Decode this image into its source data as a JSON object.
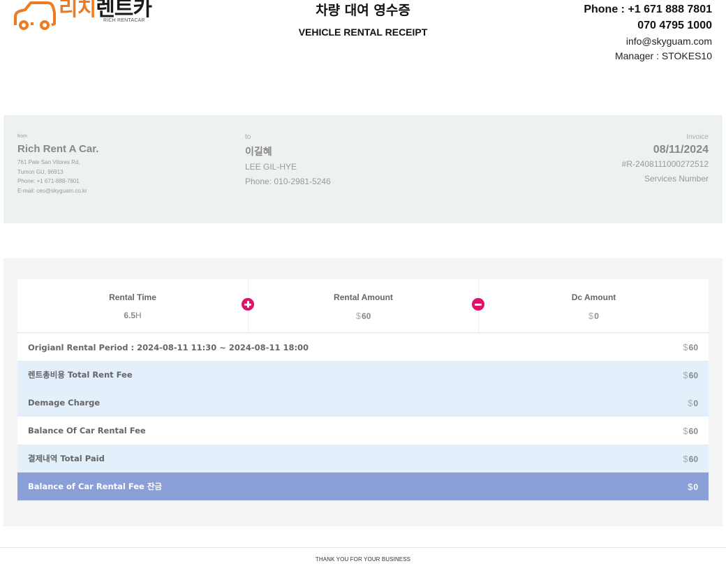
{
  "brand": {
    "name_ko_orange": "리치",
    "name_ko_dark": "렌트카",
    "name_en": "RICH RENTACAR",
    "accent_color": "#f07a1f",
    "icon": "car-logo-icon"
  },
  "title": {
    "ko": "차량 대여 영수증",
    "en": "VEHICLE RENTAL RECEIPT"
  },
  "contact": {
    "phone": "Phone : +1 671 888 7801",
    "phone2": "070 4795 1000",
    "email": "info@skyguam.com",
    "manager": "Manager : STOKES10"
  },
  "from": {
    "label": "from",
    "name": "Rich Rent A Car.",
    "address1": "761 Pale San Vitores Rd,",
    "address2": "Tumon GU, 96913",
    "phone": "Phone: +1 671-888-7801",
    "email": "E-mail: ceo@skyguam.co.kr"
  },
  "to": {
    "label": "to",
    "name_ko": "이길혜",
    "name_en": "LEE GIL-HYE",
    "phone": "Phone: 010-2981-5246"
  },
  "invoice": {
    "label": "Invoice",
    "date": "08/11/2024",
    "number": "#R-2408111000272512",
    "services": "Services Number"
  },
  "stats": {
    "rental_time": {
      "label": "Rental Time",
      "value": "6.5",
      "unit": "H"
    },
    "rental_amount": {
      "label": "Rental Amount",
      "currency": "$",
      "value": "60"
    },
    "dc_amount": {
      "label": "Dc Amount",
      "currency": "$",
      "value": "0"
    },
    "plus_icon": "plus-circle-icon",
    "minus_icon": "minus-circle-icon",
    "operator_color": "#e0116b"
  },
  "rows": [
    {
      "label": "Origianl Rental Period : 2024-08-11 11:30 ~ 2024-08-11 18:00",
      "currency": "$",
      "value": "60",
      "style": "white"
    },
    {
      "label": "렌트총비용 Total Rent Fee",
      "currency": "$",
      "value": "60",
      "style": "blue"
    },
    {
      "label": "Demage Charge",
      "currency": "$",
      "value": "0",
      "style": "blue"
    },
    {
      "label": "Balance Of Car Rental Fee",
      "currency": "$",
      "value": "60",
      "style": "white"
    },
    {
      "label": "결제내역 Total Paid",
      "currency": "$",
      "value": "60",
      "style": "blue"
    },
    {
      "label": "Balance of Car Rental Fee 잔금",
      "currency": "$",
      "value": "0",
      "style": "dark"
    }
  ],
  "footer": "THANK YOU FOR YOUR BUSINESS"
}
